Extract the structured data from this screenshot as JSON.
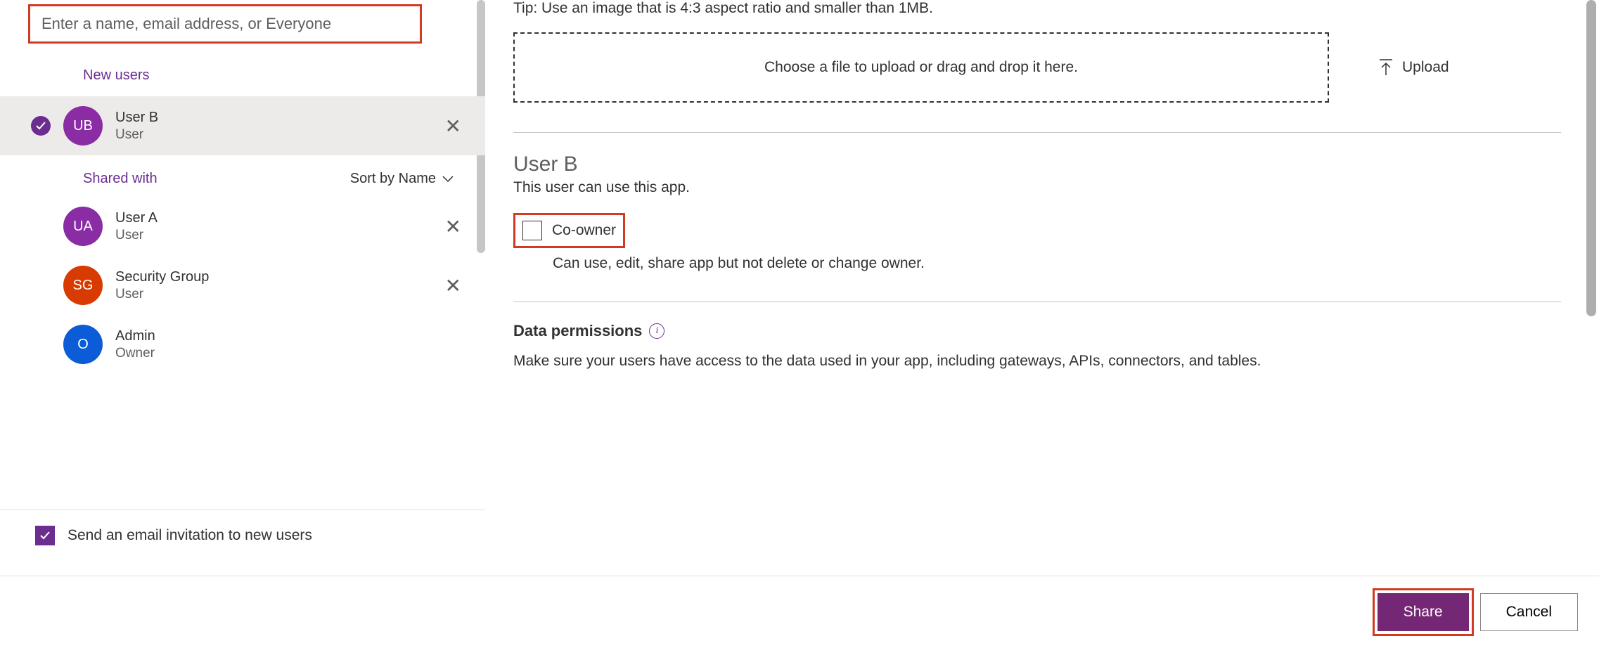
{
  "search": {
    "placeholder": "Enter a name, email address, or Everyone"
  },
  "sections": {
    "new_users": "New users",
    "shared_with": "Shared with",
    "sort": "Sort by Name"
  },
  "users": {
    "selected": {
      "initials": "UB",
      "name": "User B",
      "role": "User"
    },
    "shared": [
      {
        "initials": "UA",
        "name": "User A",
        "role": "User",
        "color": "purple",
        "removable": true
      },
      {
        "initials": "SG",
        "name": "Security Group",
        "role": "User",
        "color": "red",
        "removable": true
      },
      {
        "initials": "O",
        "name": "Admin",
        "role": "Owner",
        "color": "blue",
        "removable": false
      }
    ]
  },
  "footer": {
    "send_email": "Send an email invitation to new users"
  },
  "right": {
    "tip": "Tip: Use an image that is 4:3 aspect ratio and smaller than 1MB.",
    "dropzone": "Choose a file to upload or drag and drop it here.",
    "upload": "Upload",
    "detail_name": "User B",
    "detail_sub": "This user can use this app.",
    "coowner_label": "Co-owner",
    "coowner_desc": "Can use, edit, share app but not delete or change owner.",
    "permissions_title": "Data permissions",
    "permissions_desc": "Make sure your users have access to the data used in your app, including gateways, APIs, connectors, and tables."
  },
  "buttons": {
    "share": "Share",
    "cancel": "Cancel"
  }
}
